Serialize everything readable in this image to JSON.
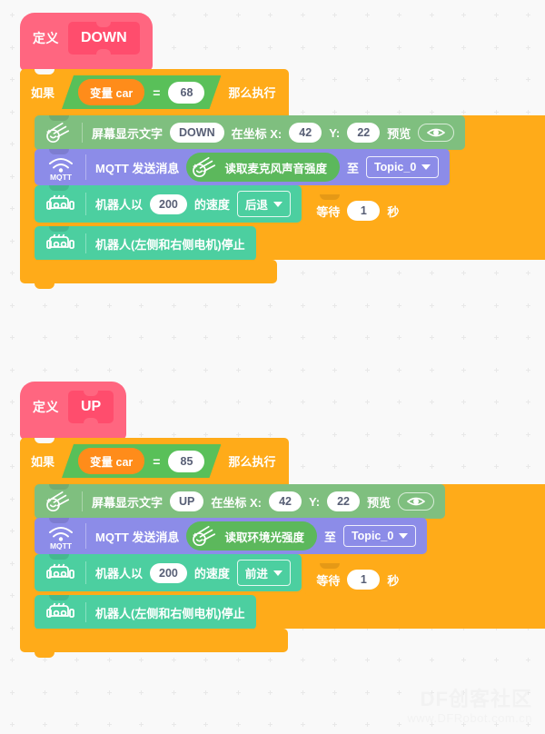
{
  "workspace": {
    "background_color": "#f9f9f9",
    "grid_dot_color": "#e8e8e8"
  },
  "watermark": {
    "line1": "DF创客社区",
    "line2": "www.DFRobot.com.cn"
  },
  "palette": {
    "hat_pink": "#FF6680",
    "proto_pink": "#FF4D6D",
    "control_orange": "#FFAB19",
    "operator_green": "#59C059",
    "variable_orange": "#FF8C1A",
    "display_green": "#7FBF7F",
    "mqtt_purple": "#8C8CE8",
    "robot_green": "#4CCFA0",
    "sensor_green": "#5CB85C"
  },
  "scripts": [
    {
      "id": "script-down",
      "hat": {
        "keyword": "定义",
        "procedure_name": "DOWN"
      },
      "if_block": {
        "keyword_if": "如果",
        "keyword_then": "那么执行",
        "condition": {
          "operator": "=",
          "left": {
            "label": "变量",
            "name": "car"
          },
          "right": "68"
        }
      },
      "body": [
        {
          "type": "display-text",
          "icon": "comet-face-icon",
          "label": "屏幕显示文字",
          "text_value": "DOWN",
          "x_label": "在坐标 X:",
          "x_value": "42",
          "y_label": "Y:",
          "y_value": "22",
          "preview_label": "预览",
          "preview_icon": "eye-icon"
        },
        {
          "type": "mqtt-send",
          "icon": "mqtt-wifi-icon",
          "icon_label": "MQTT",
          "label": "MQTT 发送消息",
          "reporter": {
            "icon": "comet-face-icon",
            "text": "读取麦克风声音强度"
          },
          "to_label": "至",
          "topic": "Topic_0"
        },
        {
          "type": "robot-move",
          "icon": "robot-car-icon",
          "label_prefix": "机器人以",
          "speed": "200",
          "label_suffix": "的速度",
          "direction": "后退"
        },
        {
          "type": "wait",
          "label_prefix": "等待",
          "seconds": "1",
          "label_suffix": "秒"
        },
        {
          "type": "robot-stop",
          "icon": "robot-car-icon",
          "label": "机器人(左侧和右侧电机)停止"
        }
      ]
    },
    {
      "id": "script-up",
      "hat": {
        "keyword": "定义",
        "procedure_name": "UP"
      },
      "if_block": {
        "keyword_if": "如果",
        "keyword_then": "那么执行",
        "condition": {
          "operator": "=",
          "left": {
            "label": "变量",
            "name": "car"
          },
          "right": "85"
        }
      },
      "body": [
        {
          "type": "display-text",
          "icon": "comet-face-icon",
          "label": "屏幕显示文字",
          "text_value": "UP",
          "x_label": "在坐标 X:",
          "x_value": "42",
          "y_label": "Y:",
          "y_value": "22",
          "preview_label": "预览",
          "preview_icon": "eye-icon"
        },
        {
          "type": "mqtt-send",
          "icon": "mqtt-wifi-icon",
          "icon_label": "MQTT",
          "label": "MQTT 发送消息",
          "reporter": {
            "icon": "comet-face-icon",
            "text": "读取环境光强度"
          },
          "to_label": "至",
          "topic": "Topic_0"
        },
        {
          "type": "robot-move",
          "icon": "robot-car-icon",
          "label_prefix": "机器人以",
          "speed": "200",
          "label_suffix": "的速度",
          "direction": "前进"
        },
        {
          "type": "wait",
          "label_prefix": "等待",
          "seconds": "1",
          "label_suffix": "秒"
        },
        {
          "type": "robot-stop",
          "icon": "robot-car-icon",
          "label": "机器人(左侧和右侧电机)停止"
        }
      ]
    }
  ]
}
